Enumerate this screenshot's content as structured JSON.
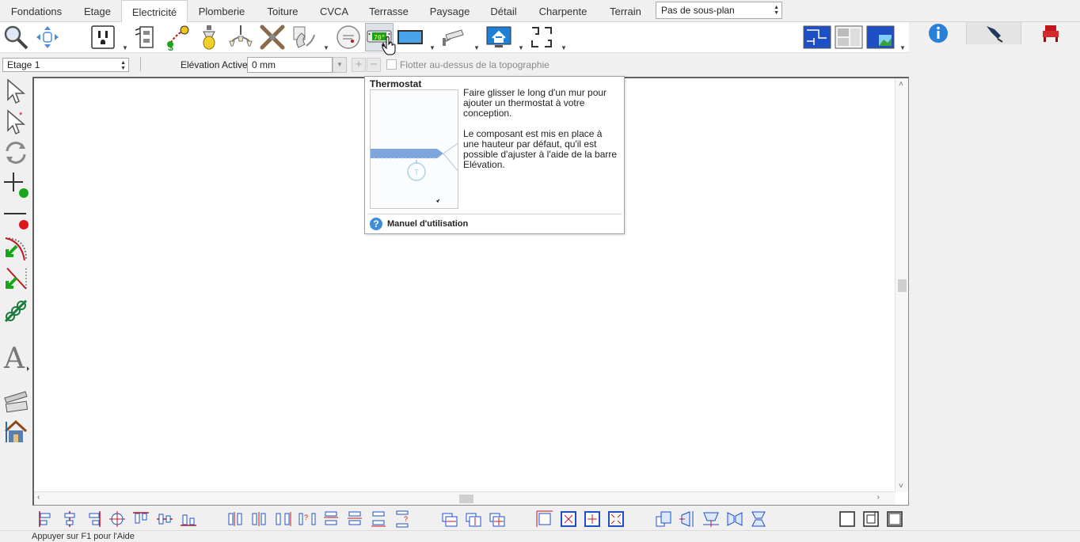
{
  "tabs": [
    {
      "label": "Fondations"
    },
    {
      "label": "Etage"
    },
    {
      "label": "Electricité"
    },
    {
      "label": "Plomberie"
    },
    {
      "label": "Toiture"
    },
    {
      "label": "CVCA"
    },
    {
      "label": "Terrasse"
    },
    {
      "label": "Paysage"
    },
    {
      "label": "Détail"
    },
    {
      "label": "Charpente"
    },
    {
      "label": "Terrain"
    }
  ],
  "active_tab": "Electricité",
  "subplan": {
    "value": "Pas de sous-plan"
  },
  "floorbar": {
    "floor_value": "Etage 1",
    "elevation_label": "Elévation Active:",
    "elevation_value": "0 mm",
    "float_label": "Flotter au-dessus de la topographie"
  },
  "tooltip": {
    "title": "Thermostat",
    "paragraph1": "Faire glisser le long d'un mur pour ajouter un thermostat à votre conception.",
    "paragraph2": "Le composant est mis en place à une hauteur par défaut, qu'il est possible d'ajuster à l'aide de la barre Elévation.",
    "help_label": "Manuel d'utilisation",
    "thermostat_display": "70°"
  },
  "status": {
    "text": "Appuyer sur F1 pour l'Aide"
  },
  "colors": {
    "accent": "#3d8ed8",
    "wall": "#7ea6dc",
    "red": "#c0171c",
    "green": "#1aa51a"
  }
}
